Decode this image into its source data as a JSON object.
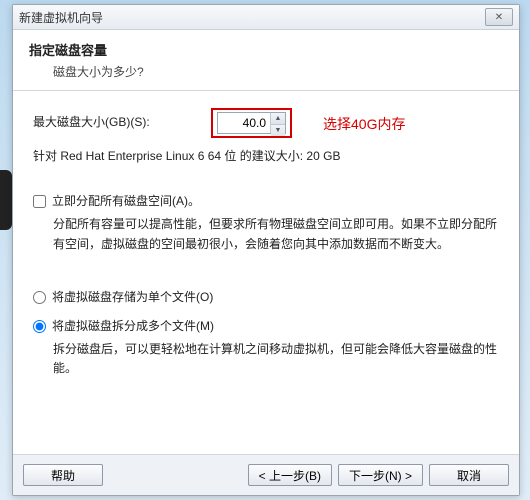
{
  "window": {
    "title": "新建虚拟机向导",
    "close_glyph": "✕"
  },
  "header": {
    "title": "指定磁盘容量",
    "subtitle": "磁盘大小为多少?"
  },
  "size": {
    "label": "最大磁盘大小(GB)(S):",
    "value": "40.0",
    "annotation": "选择40G内存",
    "hint": "针对 Red Hat Enterprise Linux 6 64 位 的建议大小: 20 GB"
  },
  "allocate": {
    "label": "立即分配所有磁盘空间(A)。",
    "desc": "分配所有容量可以提高性能，但要求所有物理磁盘空间立即可用。如果不立即分配所有空间，虚拟磁盘的空间最初很小，会随着您向其中添加数据而不断变大。"
  },
  "storage": {
    "single": {
      "label": "将虚拟磁盘存储为单个文件(O)"
    },
    "multi": {
      "label": "将虚拟磁盘拆分成多个文件(M)",
      "desc": "拆分磁盘后，可以更轻松地在计算机之间移动虚拟机，但可能会降低大容量磁盘的性能。"
    }
  },
  "buttons": {
    "help": "帮助",
    "back": "< 上一步(B)",
    "next": "下一步(N) >",
    "cancel": "取消"
  }
}
